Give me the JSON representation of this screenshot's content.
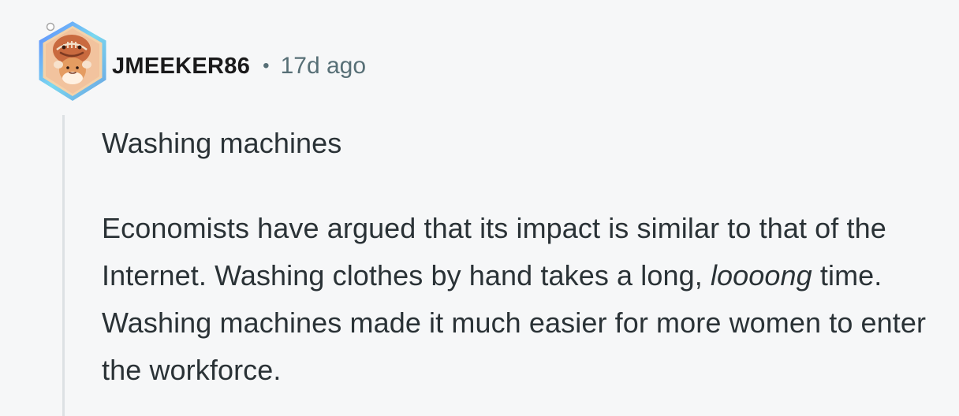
{
  "comment": {
    "author": {
      "username": "JMEEKER86",
      "avatar_icon": "football-snoo-avatar-icon"
    },
    "separator": "•",
    "timestamp": "17d ago",
    "body": {
      "paragraph_1": "Washing machines",
      "paragraph_2": {
        "part_1": "Economists have argued that its impact is similar to that of the Internet. Washing clothes by hand takes a long, ",
        "emphasis": "loooong",
        "part_2": " time. Washing machines made it much easier for more women to enter the workforce."
      }
    }
  },
  "colors": {
    "background": "#f6f7f8",
    "text": "#2a3236",
    "meta_text": "#576f76",
    "thread_line": "#dde1e4",
    "avatar_border": "#6aa4e3",
    "avatar_bg": "#e6a86a"
  }
}
